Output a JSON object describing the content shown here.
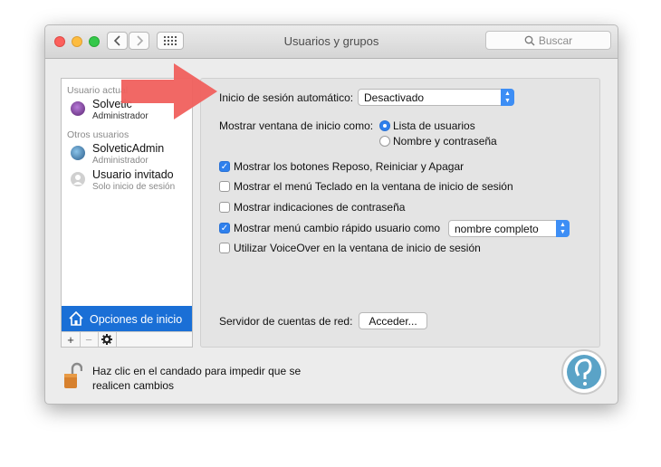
{
  "window": {
    "title": "Usuarios y grupos"
  },
  "toolbar": {
    "search_placeholder": "Buscar"
  },
  "sidebar": {
    "current_section": "Usuario actual",
    "current_user": {
      "name": "Solvetic",
      "role": "Administrador"
    },
    "other_section": "Otros usuarios",
    "other_users": [
      {
        "name": "SolveticAdmin",
        "role": "Administrador"
      },
      {
        "name": "Usuario invitado",
        "role": "Solo inicio de sesión"
      }
    ],
    "login_options": "Opciones de inicio",
    "add_icon": "+",
    "remove_icon": "−"
  },
  "login": {
    "auto_login_label": "Inicio de sesión automático:",
    "auto_login_value": "Desactivado",
    "show_window_label": "Mostrar ventana de inicio como:",
    "radio_users_list": "Lista de usuarios",
    "radio_name_password": "Nombre y contraseña",
    "selected_radio": "Lista de usuarios",
    "checkboxes": [
      {
        "label": "Mostrar los botones Reposo, Reiniciar y Apagar",
        "checked": true
      },
      {
        "label": "Mostrar el menú Teclado en la ventana de inicio de sesión",
        "checked": false
      },
      {
        "label": "Mostrar indicaciones de contraseña",
        "checked": false
      },
      {
        "label": "Mostrar menú cambio rápido usuario como",
        "checked": true
      },
      {
        "label": "Utilizar VoiceOver en la ventana de inicio de sesión",
        "checked": false
      }
    ],
    "fast_switch_value": "nombre completo",
    "network_server_label": "Servidor de cuentas de red:",
    "access_button": "Acceder..."
  },
  "footer": {
    "lock_text_line1": "Haz clic en el candado para impedir que se",
    "lock_text_line2": "realicen cambios"
  },
  "colors": {
    "accent": "#2f80ed",
    "selection": "#1a6fd6",
    "arrow": "#f0605d",
    "watermark": "#5aa3c7"
  },
  "icons": [
    "back-icon",
    "forward-icon",
    "grid-icon",
    "search-icon",
    "house-icon",
    "gear-icon",
    "lock-icon",
    "arrow-annotation-icon",
    "watermark-logo-icon"
  ]
}
